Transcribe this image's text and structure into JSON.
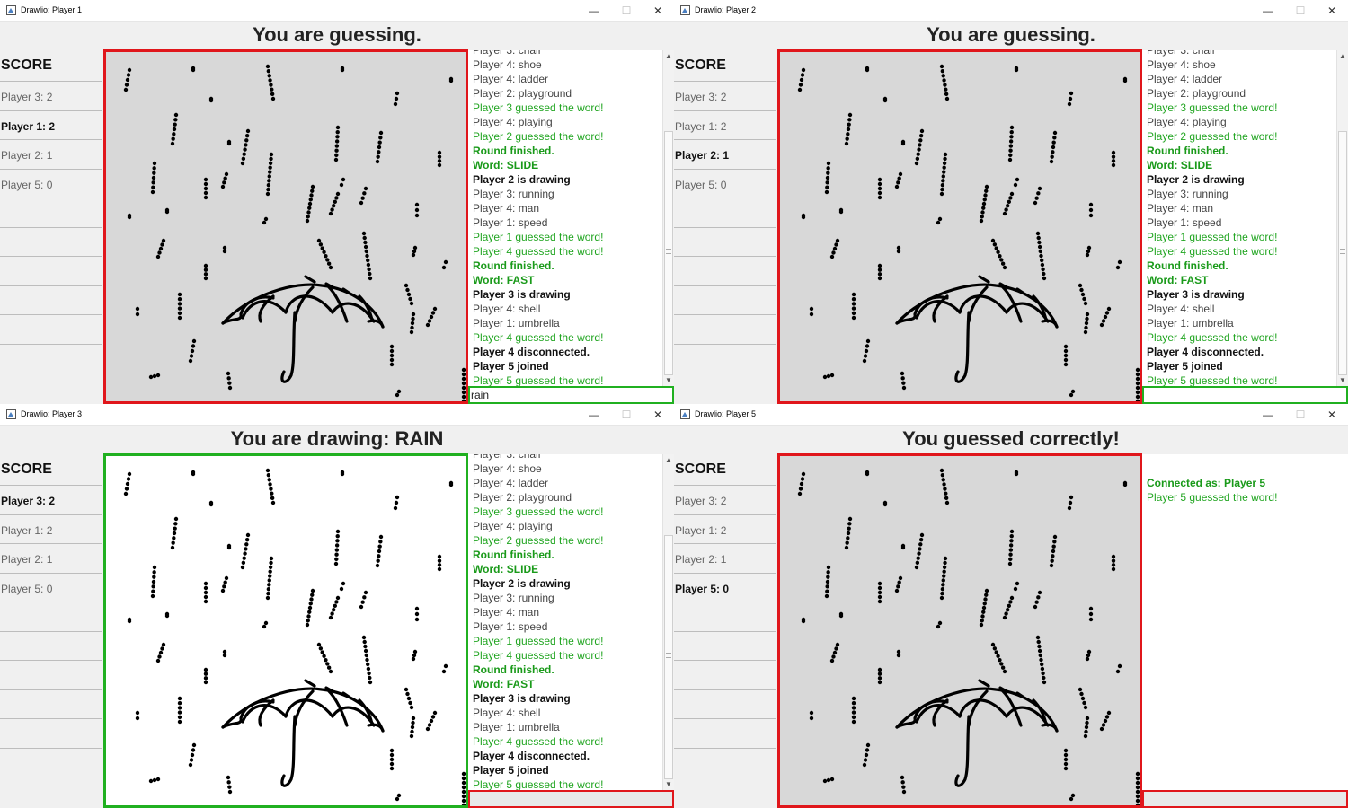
{
  "windows": [
    {
      "title": "Drawlio: Player 1",
      "heading": "You are guessing.",
      "mode": "guess",
      "score_me": 1,
      "show_scrollbar": true,
      "input_value": "rain",
      "input_state": "green",
      "chat_key": "full"
    },
    {
      "title": "Drawlio: Player 2",
      "heading": "You are guessing.",
      "mode": "guess",
      "score_me": 2,
      "show_scrollbar": true,
      "input_value": "",
      "input_state": "green",
      "chat_key": "full"
    },
    {
      "title": "Drawlio: Player 3",
      "heading": "You are drawing: RAIN",
      "mode": "draw",
      "score_me": 0,
      "show_scrollbar": true,
      "input_value": "",
      "input_state": "red",
      "chat_key": "full"
    },
    {
      "title": "Drawlio: Player 5",
      "heading": "You guessed correctly!",
      "mode": "guess",
      "score_me": 3,
      "show_scrollbar": false,
      "input_value": "",
      "input_state": "red",
      "chat_key": "p5"
    }
  ],
  "window_controls": {
    "minimize": "—",
    "maximize": "☐",
    "close": "✕"
  },
  "score": {
    "title": "SCORE",
    "entries": [
      "Player 3: 2",
      "Player 1: 2",
      "Player 2: 1",
      "Player 5: 0"
    ]
  },
  "chat": {
    "full": [
      {
        "text": "Player 3: chair",
        "style": "normal"
      },
      {
        "text": "Player 4: shoe",
        "style": "normal"
      },
      {
        "text": "Player 4: ladder",
        "style": "normal"
      },
      {
        "text": "Player 2: playground",
        "style": "normal"
      },
      {
        "text": "Player 3 guessed the word!",
        "style": "green"
      },
      {
        "text": "Player 4: playing",
        "style": "normal"
      },
      {
        "text": "Player 2 guessed the word!",
        "style": "green"
      },
      {
        "text": "Round finished.",
        "style": "bgreen"
      },
      {
        "text": "Word: SLIDE",
        "style": "bgreen"
      },
      {
        "text": "Player 2 is drawing",
        "style": "bold"
      },
      {
        "text": "Player 3: running",
        "style": "normal"
      },
      {
        "text": "Player 4: man",
        "style": "normal"
      },
      {
        "text": "Player 1: speed",
        "style": "normal"
      },
      {
        "text": "Player 1 guessed the word!",
        "style": "green"
      },
      {
        "text": "Player 4 guessed the word!",
        "style": "green"
      },
      {
        "text": "Round finished.",
        "style": "bgreen"
      },
      {
        "text": "Word: FAST",
        "style": "bgreen"
      },
      {
        "text": "Player 3 is drawing",
        "style": "bold"
      },
      {
        "text": "Player 4: shell",
        "style": "normal"
      },
      {
        "text": "Player 1: umbrella",
        "style": "normal"
      },
      {
        "text": "Player 4 guessed the word!",
        "style": "green"
      },
      {
        "text": "Player 4 disconnected.",
        "style": "bold"
      },
      {
        "text": "Player 5 joined",
        "style": "bold"
      },
      {
        "text": "Player 5 guessed the word!",
        "style": "green"
      }
    ],
    "p5": [
      {
        "text": "",
        "style": "normal"
      },
      {
        "text": "",
        "style": "normal"
      },
      {
        "text": "Connected as: Player 5",
        "style": "bgreen"
      },
      {
        "text": "Player 5 guessed the word!",
        "style": "green"
      }
    ]
  }
}
